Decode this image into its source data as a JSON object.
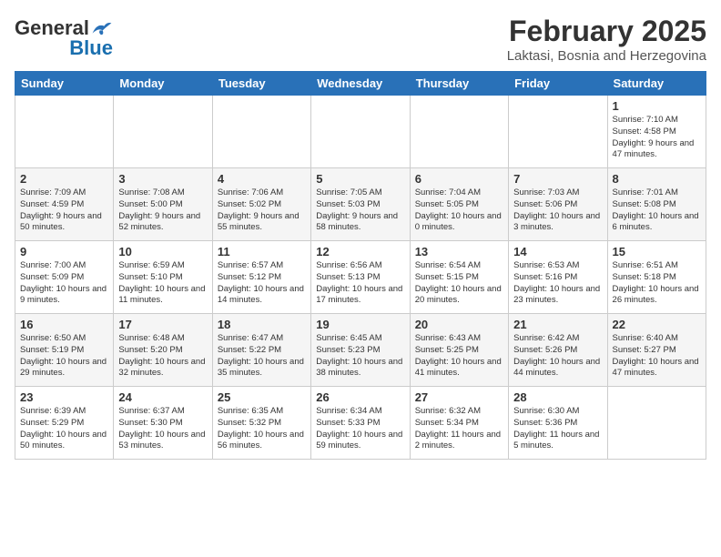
{
  "header": {
    "logo": {
      "general": "General",
      "blue": "Blue"
    },
    "title": "February 2025",
    "location": "Laktasi, Bosnia and Herzegovina"
  },
  "weekdays": [
    "Sunday",
    "Monday",
    "Tuesday",
    "Wednesday",
    "Thursday",
    "Friday",
    "Saturday"
  ],
  "weeks": [
    [
      {
        "day": "",
        "info": ""
      },
      {
        "day": "",
        "info": ""
      },
      {
        "day": "",
        "info": ""
      },
      {
        "day": "",
        "info": ""
      },
      {
        "day": "",
        "info": ""
      },
      {
        "day": "",
        "info": ""
      },
      {
        "day": "1",
        "info": "Sunrise: 7:10 AM\nSunset: 4:58 PM\nDaylight: 9 hours and 47 minutes."
      }
    ],
    [
      {
        "day": "2",
        "info": "Sunrise: 7:09 AM\nSunset: 4:59 PM\nDaylight: 9 hours and 50 minutes."
      },
      {
        "day": "3",
        "info": "Sunrise: 7:08 AM\nSunset: 5:00 PM\nDaylight: 9 hours and 52 minutes."
      },
      {
        "day": "4",
        "info": "Sunrise: 7:06 AM\nSunset: 5:02 PM\nDaylight: 9 hours and 55 minutes."
      },
      {
        "day": "5",
        "info": "Sunrise: 7:05 AM\nSunset: 5:03 PM\nDaylight: 9 hours and 58 minutes."
      },
      {
        "day": "6",
        "info": "Sunrise: 7:04 AM\nSunset: 5:05 PM\nDaylight: 10 hours and 0 minutes."
      },
      {
        "day": "7",
        "info": "Sunrise: 7:03 AM\nSunset: 5:06 PM\nDaylight: 10 hours and 3 minutes."
      },
      {
        "day": "8",
        "info": "Sunrise: 7:01 AM\nSunset: 5:08 PM\nDaylight: 10 hours and 6 minutes."
      }
    ],
    [
      {
        "day": "9",
        "info": "Sunrise: 7:00 AM\nSunset: 5:09 PM\nDaylight: 10 hours and 9 minutes."
      },
      {
        "day": "10",
        "info": "Sunrise: 6:59 AM\nSunset: 5:10 PM\nDaylight: 10 hours and 11 minutes."
      },
      {
        "day": "11",
        "info": "Sunrise: 6:57 AM\nSunset: 5:12 PM\nDaylight: 10 hours and 14 minutes."
      },
      {
        "day": "12",
        "info": "Sunrise: 6:56 AM\nSunset: 5:13 PM\nDaylight: 10 hours and 17 minutes."
      },
      {
        "day": "13",
        "info": "Sunrise: 6:54 AM\nSunset: 5:15 PM\nDaylight: 10 hours and 20 minutes."
      },
      {
        "day": "14",
        "info": "Sunrise: 6:53 AM\nSunset: 5:16 PM\nDaylight: 10 hours and 23 minutes."
      },
      {
        "day": "15",
        "info": "Sunrise: 6:51 AM\nSunset: 5:18 PM\nDaylight: 10 hours and 26 minutes."
      }
    ],
    [
      {
        "day": "16",
        "info": "Sunrise: 6:50 AM\nSunset: 5:19 PM\nDaylight: 10 hours and 29 minutes."
      },
      {
        "day": "17",
        "info": "Sunrise: 6:48 AM\nSunset: 5:20 PM\nDaylight: 10 hours and 32 minutes."
      },
      {
        "day": "18",
        "info": "Sunrise: 6:47 AM\nSunset: 5:22 PM\nDaylight: 10 hours and 35 minutes."
      },
      {
        "day": "19",
        "info": "Sunrise: 6:45 AM\nSunset: 5:23 PM\nDaylight: 10 hours and 38 minutes."
      },
      {
        "day": "20",
        "info": "Sunrise: 6:43 AM\nSunset: 5:25 PM\nDaylight: 10 hours and 41 minutes."
      },
      {
        "day": "21",
        "info": "Sunrise: 6:42 AM\nSunset: 5:26 PM\nDaylight: 10 hours and 44 minutes."
      },
      {
        "day": "22",
        "info": "Sunrise: 6:40 AM\nSunset: 5:27 PM\nDaylight: 10 hours and 47 minutes."
      }
    ],
    [
      {
        "day": "23",
        "info": "Sunrise: 6:39 AM\nSunset: 5:29 PM\nDaylight: 10 hours and 50 minutes."
      },
      {
        "day": "24",
        "info": "Sunrise: 6:37 AM\nSunset: 5:30 PM\nDaylight: 10 hours and 53 minutes."
      },
      {
        "day": "25",
        "info": "Sunrise: 6:35 AM\nSunset: 5:32 PM\nDaylight: 10 hours and 56 minutes."
      },
      {
        "day": "26",
        "info": "Sunrise: 6:34 AM\nSunset: 5:33 PM\nDaylight: 10 hours and 59 minutes."
      },
      {
        "day": "27",
        "info": "Sunrise: 6:32 AM\nSunset: 5:34 PM\nDaylight: 11 hours and 2 minutes."
      },
      {
        "day": "28",
        "info": "Sunrise: 6:30 AM\nSunset: 5:36 PM\nDaylight: 11 hours and 5 minutes."
      },
      {
        "day": "",
        "info": ""
      }
    ]
  ]
}
